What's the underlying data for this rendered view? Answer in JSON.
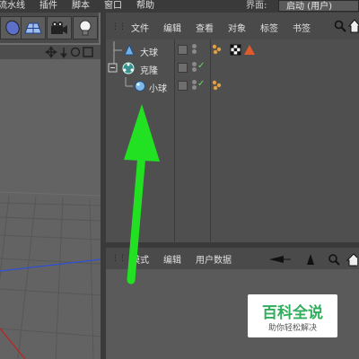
{
  "menubar": {
    "items": [
      "流水线",
      "插件",
      "脚本",
      "窗口",
      "帮助"
    ],
    "layout_label": "界面:",
    "layout_value": "启动 (用户)"
  },
  "object_manager": {
    "menu": [
      "文件",
      "编辑",
      "查看",
      "对象",
      "标签",
      "书签"
    ],
    "objects": [
      {
        "name": "大球"
      },
      {
        "name": "克隆"
      },
      {
        "name": "小球"
      }
    ]
  },
  "attribute_manager": {
    "menu": [
      "模式",
      "编辑",
      "用户数据"
    ]
  },
  "watermark": {
    "title": "百科全说",
    "subtitle": "助你轻松解决"
  },
  "colors": {
    "annotation_arrow": "#22e022",
    "checkmark": "#6fd36f",
    "watermark_green": "#2fae5b"
  }
}
